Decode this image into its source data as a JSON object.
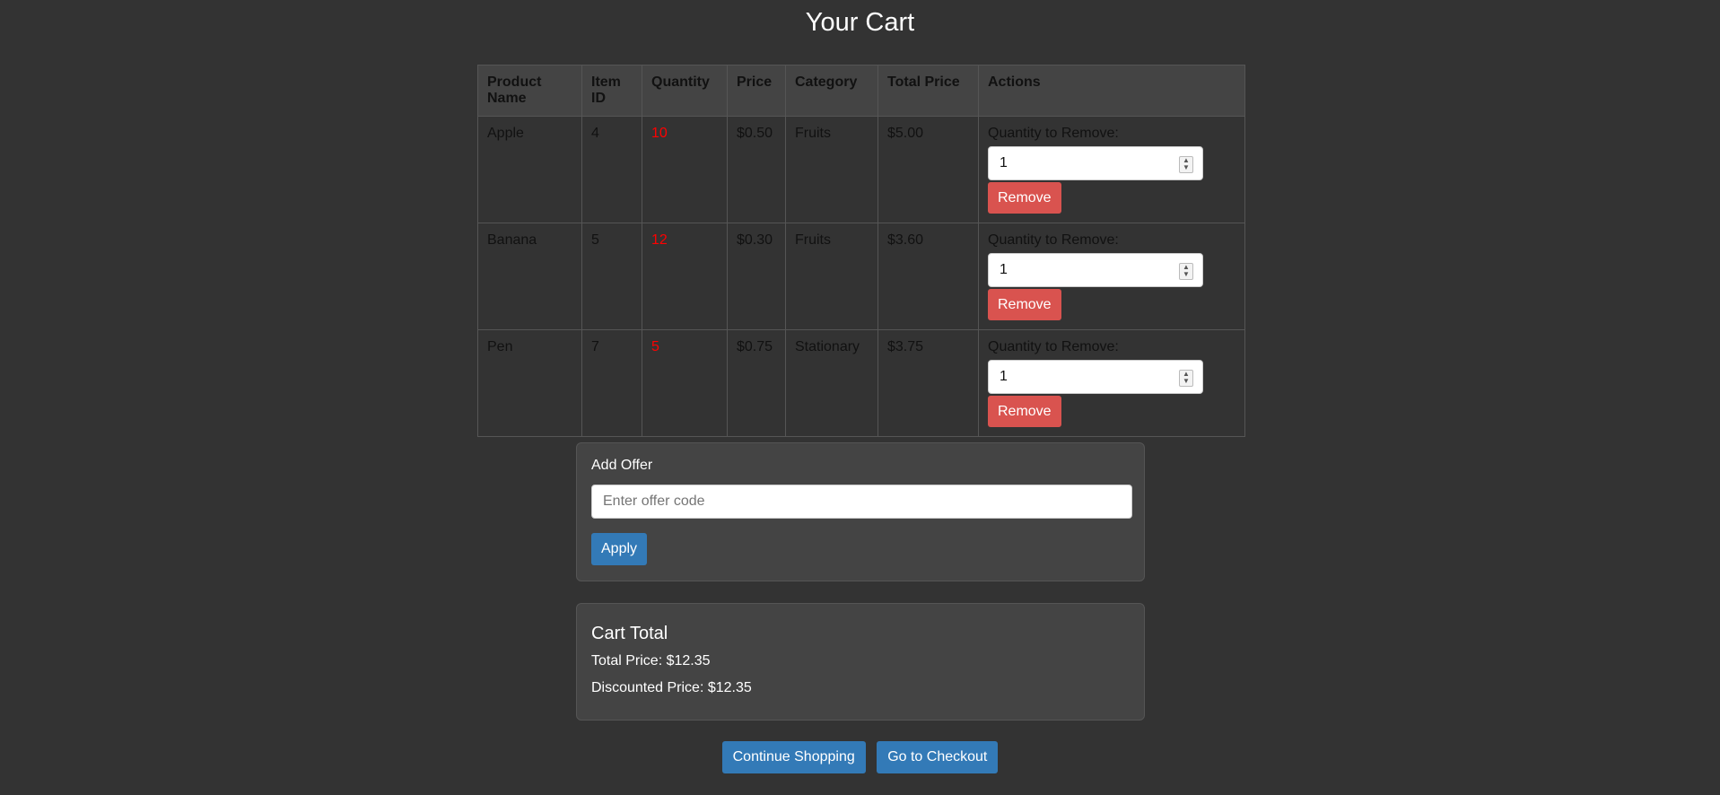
{
  "page": {
    "title": "Your Cart"
  },
  "table": {
    "headers": [
      "Product Name",
      "Item ID",
      "Quantity",
      "Price",
      "Category",
      "Total Price",
      "Actions"
    ],
    "rows": [
      {
        "name": "Apple",
        "id": "4",
        "quantity": "10",
        "price": "$0.50",
        "category": "Fruits",
        "total": "$5.00",
        "remove_label": "Quantity to Remove:",
        "remove_qty": "1",
        "remove_button": "Remove"
      },
      {
        "name": "Banana",
        "id": "5",
        "quantity": "12",
        "price": "$0.30",
        "category": "Fruits",
        "total": "$3.60",
        "remove_label": "Quantity to Remove:",
        "remove_qty": "1",
        "remove_button": "Remove"
      },
      {
        "name": "Pen",
        "id": "7",
        "quantity": "5",
        "price": "$0.75",
        "category": "Stationary",
        "total": "$3.75",
        "remove_label": "Quantity to Remove:",
        "remove_qty": "1",
        "remove_button": "Remove"
      }
    ]
  },
  "offer": {
    "label": "Add Offer",
    "placeholder": "Enter offer code",
    "apply_label": "Apply"
  },
  "totals": {
    "heading": "Cart Total",
    "total_price": "Total Price: $12.35",
    "discounted_price": "Discounted Price: $12.35"
  },
  "actions": {
    "continue_label": "Continue Shopping",
    "checkout_label": "Go to Checkout"
  },
  "colors": {
    "background": "#333333",
    "panel": "#444444",
    "remove": "#d9534f",
    "primary": "#337ab7",
    "quantity": "#ff0000"
  }
}
